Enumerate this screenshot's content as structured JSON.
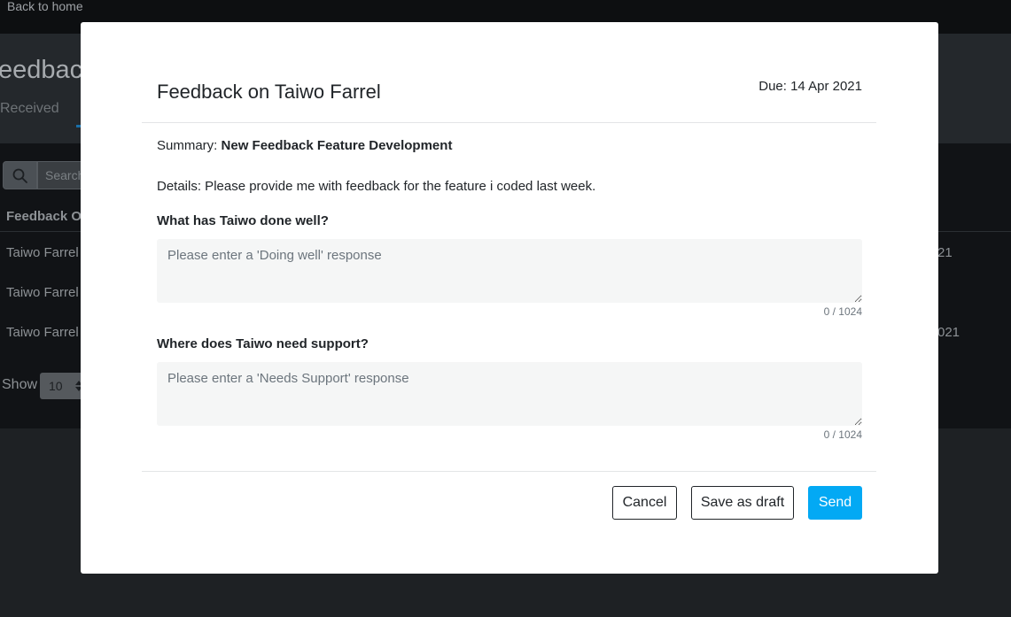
{
  "background": {
    "back_link": "Back to home",
    "page_title": "eedback",
    "tab_received": "Received",
    "search_placeholder": "Search",
    "column_header": "Feedback O",
    "rows": [
      {
        "name": "Taiwo Farrel",
        "right": "21"
      },
      {
        "name": "Taiwo Farrel",
        "right": ""
      },
      {
        "name": "Taiwo Farrel",
        "right": "021"
      }
    ],
    "show_label": "Show",
    "page_size": "10"
  },
  "modal": {
    "title": "Feedback on Taiwo Farrel",
    "due": "Due: 14 Apr 2021",
    "summary_label": "Summary:",
    "summary_value": "New Feedback Feature Development",
    "details": "Details: Please provide me with feedback for the feature i coded last week.",
    "doing_well": {
      "question": "What has Taiwo done well?",
      "placeholder": "Please enter a 'Doing well' response",
      "value": "",
      "counter": "0 / 1024"
    },
    "needs_support": {
      "question": "Where does Taiwo need support?",
      "placeholder": "Please enter a 'Needs Support' response",
      "value": "",
      "counter": "0 / 1024"
    },
    "buttons": {
      "cancel": "Cancel",
      "save_draft": "Save as draft",
      "send": "Send"
    }
  },
  "colors": {
    "accent": "#03a9f4",
    "overlay_background": "#1e2124",
    "textarea_background": "#f5f6f6"
  },
  "icons": {
    "search": "search-icon",
    "select_arrows": "updown-arrows-icon"
  }
}
